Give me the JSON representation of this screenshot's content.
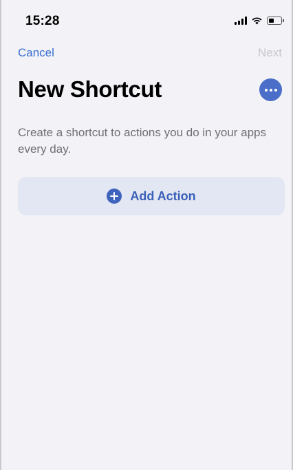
{
  "status_bar": {
    "time": "15:28",
    "icons": [
      "cellular-signal-icon",
      "wifi-icon",
      "battery-icon"
    ]
  },
  "nav": {
    "cancel_label": "Cancel",
    "next_label": "Next"
  },
  "page": {
    "title": "New Shortcut",
    "more_icon": "ellipsis-icon",
    "description": "Create a shortcut to actions you do in your apps every day.",
    "add_action_label": "Add Action",
    "add_action_icon": "plus-circle-icon"
  },
  "colors": {
    "accent": "#3a6fd1",
    "disabled": "#c7c7cc",
    "background": "#f2f2f7",
    "add_action_background": "#e2e7f3"
  }
}
